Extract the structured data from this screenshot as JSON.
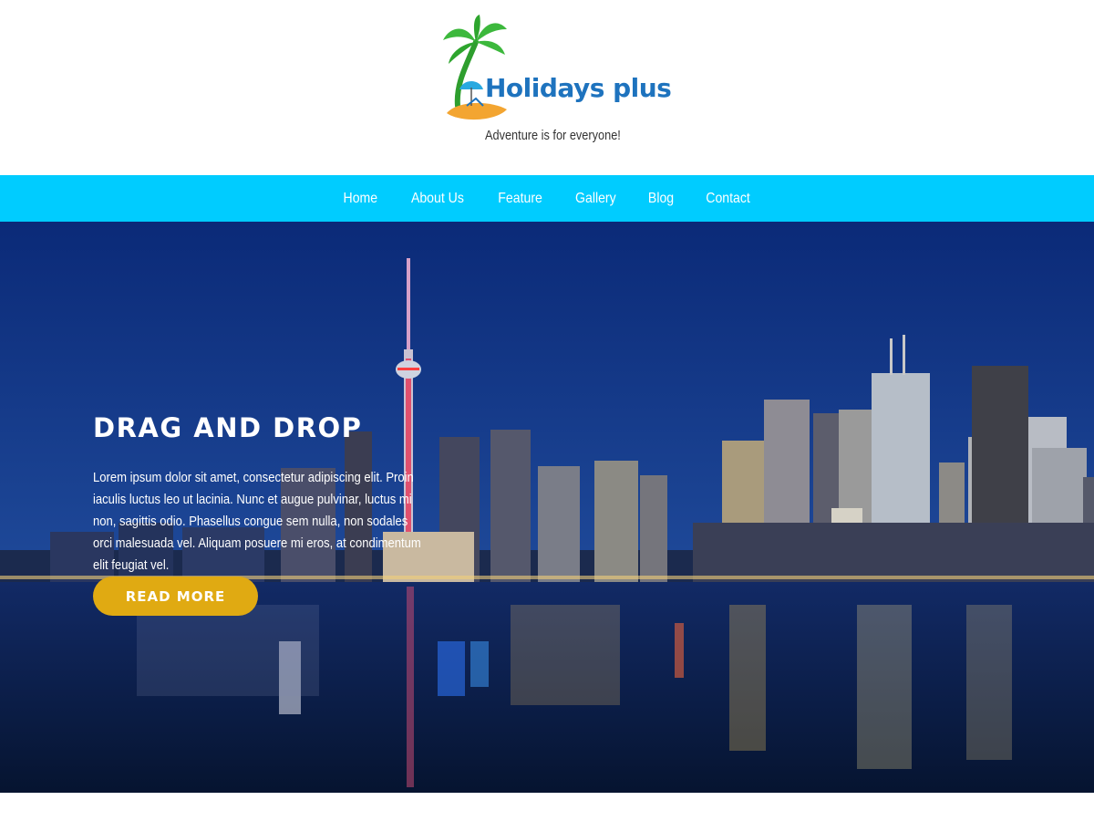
{
  "header": {
    "brand_name": "Holidays plus",
    "tagline": "Adventure is for everyone!",
    "logo_icon": "palm-tree-beach-logo"
  },
  "nav": {
    "items": [
      {
        "label": "Home"
      },
      {
        "label": "About Us"
      },
      {
        "label": "Feature"
      },
      {
        "label": "Gallery"
      },
      {
        "label": "Blog"
      },
      {
        "label": "Contact"
      }
    ]
  },
  "hero": {
    "title": "DRAG AND DROP",
    "text": "Lorem ipsum dolor sit amet, consectetur adipiscing elit. Proin iaculis luctus leo ut lacinia. Nunc et augue pulvinar, luctus mi non, sagittis odio. Phasellus congue sem nulla, non sodales orci malesuada vel. Aliquam posuere mi eros, at condimentum elit feugiat vel.",
    "button_label": "READ MORE",
    "background": "city-skyline-night-image"
  },
  "colors": {
    "nav_bg": "#00ccff",
    "brand": "#1e73be",
    "button": "#e0aa12"
  }
}
